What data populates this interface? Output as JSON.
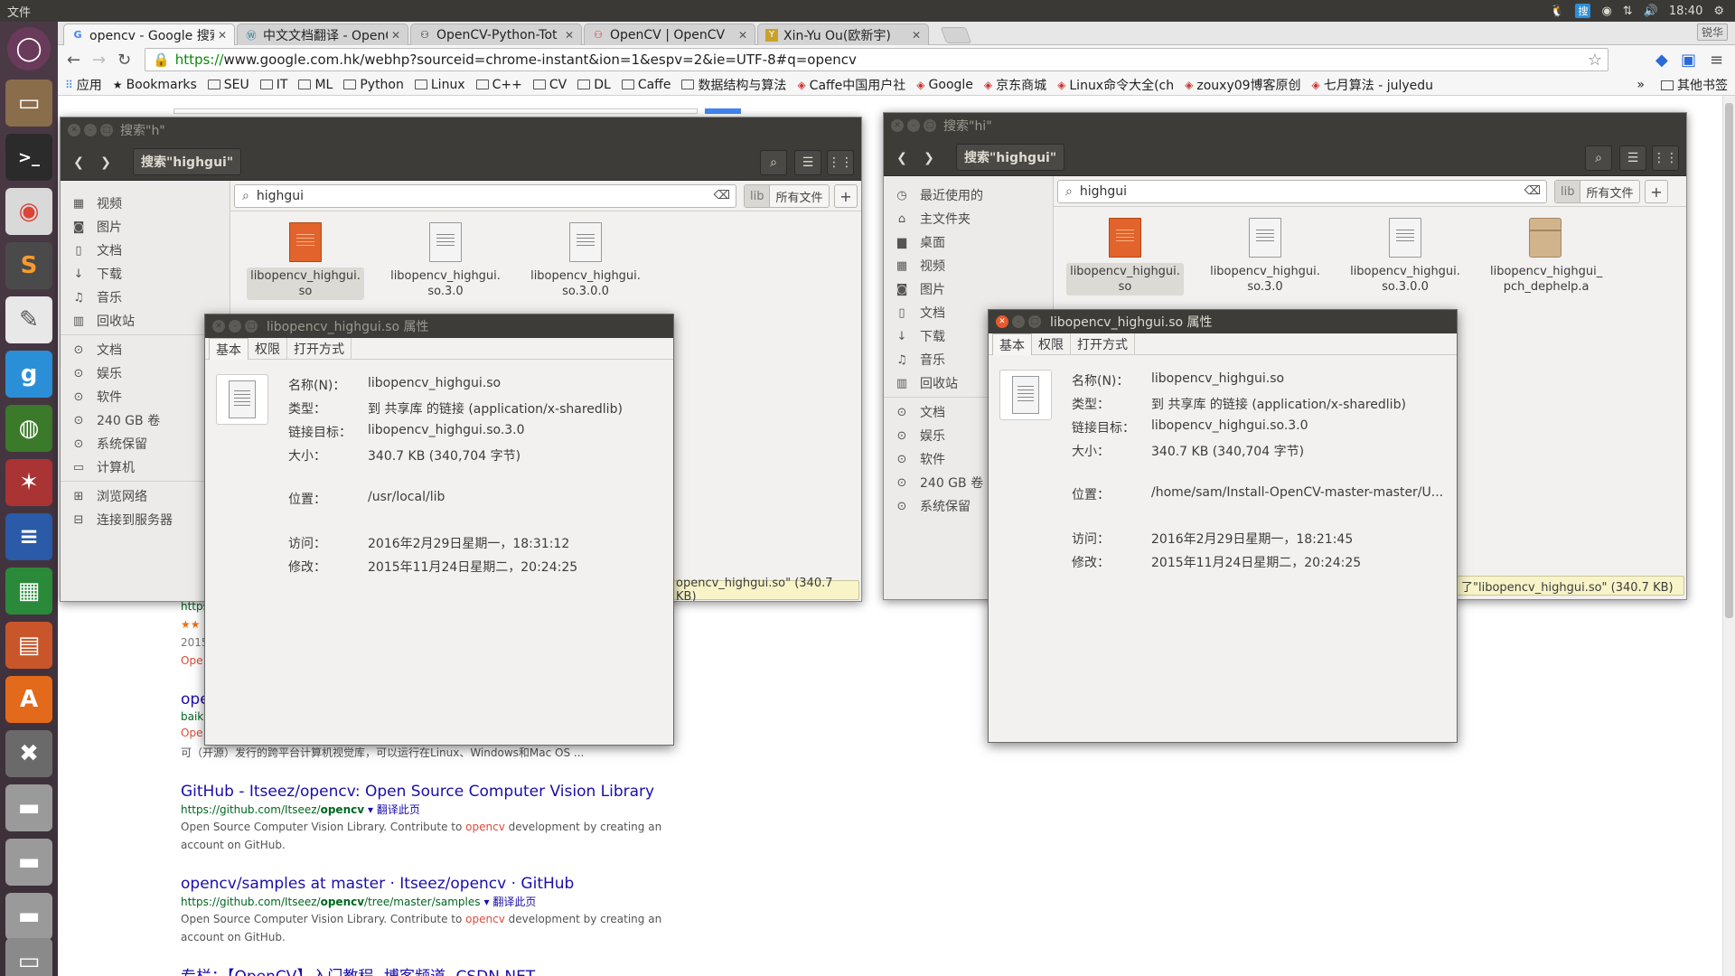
{
  "topbar": {
    "app": "文件",
    "time": "18:40"
  },
  "chrome": {
    "tabs": [
      {
        "title": "opencv - Google 搜索",
        "favicon": "google-g-icon"
      },
      {
        "title": "中文文档翻译 - OpenCV",
        "favicon": "wordpress-icon"
      },
      {
        "title": "OpenCV-Python-Tot",
        "favicon": "github-icon"
      },
      {
        "title": "OpenCV | OpenCV",
        "favicon": "opencv-icon"
      },
      {
        "title": "Xin-Yu Ou(欧新宇)",
        "favicon": "y-icon"
      }
    ],
    "user_button": "锐华",
    "url_scheme": "https://",
    "url_rest": "www.google.com.hk/webhp?sourceid=chrome-instant&ion=1&espv=2&ie=UTF-8#q=opencv",
    "bookmarks": [
      {
        "label": "应用",
        "type": "apps"
      },
      {
        "label": "Bookmarks",
        "type": "star"
      },
      {
        "label": "SEU",
        "type": "folder"
      },
      {
        "label": "IT",
        "type": "folder"
      },
      {
        "label": "ML",
        "type": "folder"
      },
      {
        "label": "Python",
        "type": "folder"
      },
      {
        "label": "Linux",
        "type": "folder"
      },
      {
        "label": "C++",
        "type": "folder"
      },
      {
        "label": "CV",
        "type": "folder"
      },
      {
        "label": "DL",
        "type": "folder"
      },
      {
        "label": "Caffe",
        "type": "folder"
      },
      {
        "label": "数据结构与算法",
        "type": "folder"
      },
      {
        "label": "Caffe中国用户社",
        "type": "site"
      },
      {
        "label": "Google",
        "type": "site"
      },
      {
        "label": "京东商城",
        "type": "site"
      },
      {
        "label": "Linux命令大全(ch",
        "type": "site"
      },
      {
        "label": "zouxy09博客原创",
        "type": "site"
      },
      {
        "label": "七月算法 - julyedu",
        "type": "site"
      }
    ],
    "bookmarks_more": "»",
    "other_bookmarks": "其他书签"
  },
  "search_results": {
    "frag1": "https",
    "frag2": "2015",
    "frag3": "Ope",
    "frag4": "ope",
    "frag5": "baik",
    "frag6": "Ope",
    "frag7": "可（开源）发行的跨平台计算机视觉库，可以运行在Linux、Windows和Mac OS ...",
    "results": [
      {
        "title": "GitHub - Itseez/opencv: Open Source Computer Vision Library",
        "url_pre": "https://github.com/Itseez/",
        "url_bold": "opencv",
        "url_post": "",
        "translate": "▾ 翻译此页",
        "snippet_pre": "Open Source Computer Vision Library. Contribute to ",
        "snippet_hl": "opencv",
        "snippet_post": " development by creating an",
        "snippet2": "account on GitHub."
      },
      {
        "title": "opencv/samples at master · Itseez/opencv · GitHub",
        "url_pre": "https://github.com/Itseez/",
        "url_bold": "opencv",
        "url_post": "/tree/master/samples",
        "translate": "▾ 翻译此页",
        "snippet_pre": "Open Source Computer Vision Library. Contribute to ",
        "snippet_hl": "opencv",
        "snippet_post": " development by creating an",
        "snippet2": "account on GitHub."
      }
    ],
    "cut_title": "专栏：【OpenCV】入门教程- 博客频道- CSDN.NET"
  },
  "nautilus_left": {
    "title": "搜索\"h\"",
    "path": "搜索\"highgui\"",
    "search_value": "highgui",
    "filter_lib": "lib",
    "filter_all": "所有文件",
    "sidebar": [
      "视频",
      "图片",
      "文档",
      "下载",
      "音乐",
      "回收站",
      "文档",
      "娱乐",
      "软件",
      "240 GB 卷",
      "系统保留",
      "计算机",
      "浏览网络",
      "连接到服务器"
    ],
    "files": [
      {
        "line1": "libopencv_highgui.",
        "line2": "so"
      },
      {
        "line1": "libopencv_highgui.",
        "line2": "so.3.0"
      },
      {
        "line1": "libopencv_highgui.",
        "line2": "so.3.0.0"
      }
    ],
    "status": "opencv_highgui.so\" (340.7 KB)"
  },
  "nautilus_right": {
    "title": "搜索\"hi\"",
    "path": "搜索\"highgui\"",
    "search_value": "highgui",
    "filter_lib": "lib",
    "filter_all": "所有文件",
    "sidebar": [
      "最近使用的",
      "主文件夹",
      "桌面",
      "视频",
      "图片",
      "文档",
      "下载",
      "音乐",
      "回收站",
      "文档",
      "娱乐",
      "软件",
      "240 GB 卷",
      "系统保留"
    ],
    "files": [
      {
        "line1": "libopencv_highgui.",
        "line2": "so"
      },
      {
        "line1": "libopencv_highgui.",
        "line2": "so.3.0"
      },
      {
        "line1": "libopencv_highgui.",
        "line2": "so.3.0.0"
      },
      {
        "line1": "libopencv_highgui_",
        "line2": "pch_dephelp.a"
      }
    ],
    "status": "了\"libopencv_highgui.so\" (340.7 KB)"
  },
  "props_left": {
    "title": "libopencv_highgui.so 属性",
    "tabs": [
      "基本",
      "权限",
      "打开方式"
    ],
    "name_k": "名称(N)：",
    "name_v": "libopencv_highgui.so",
    "type_k": "类型：",
    "type_v": "到 共享库 的链接 (application/x-sharedlib)",
    "link_k": "链接目标：",
    "link_v": "libopencv_highgui.so.3.0",
    "size_k": "大小：",
    "size_v": "340.7 KB (340,704 字节)",
    "loc_k": "位置：",
    "loc_v": "/usr/local/lib",
    "acc_k": "访问：",
    "acc_v": "2016年2月29日星期一，18:31:12",
    "mod_k": "修改：",
    "mod_v": "2015年11月24日星期二，20:24:25"
  },
  "props_right": {
    "title": "libopencv_highgui.so 属性",
    "tabs": [
      "基本",
      "权限",
      "打开方式"
    ],
    "name_k": "名称(N)：",
    "name_v": "libopencv_highgui.so",
    "type_k": "类型：",
    "type_v": "到 共享库 的链接 (application/x-sharedlib)",
    "link_k": "链接目标：",
    "link_v": "libopencv_highgui.so.3.0",
    "size_k": "大小：",
    "size_v": "340.7 KB (340,704 字节)",
    "loc_k": "位置：",
    "loc_v": "/home/sam/Install-OpenCV-master-master/U...",
    "acc_k": "访问：",
    "acc_v": "2016年2月29日星期一，18:21:45",
    "mod_k": "修改：",
    "mod_v": "2015年11月24日星期二，20:24:25"
  }
}
